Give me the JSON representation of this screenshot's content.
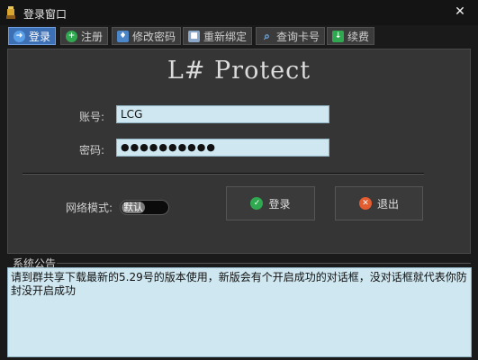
{
  "window": {
    "title": "登录窗口",
    "close_glyph": "✕"
  },
  "toolbar": {
    "items": [
      {
        "label": "登录",
        "icon": "login-icon",
        "active": true
      },
      {
        "label": "注册",
        "icon": "register-icon",
        "active": false
      },
      {
        "label": "修改密码",
        "icon": "change-password-icon",
        "active": false
      },
      {
        "label": "重新绑定",
        "icon": "rebind-icon",
        "active": false
      },
      {
        "label": "查询卡号",
        "icon": "search-icon",
        "active": false
      },
      {
        "label": "续费",
        "icon": "renew-icon",
        "active": false
      }
    ]
  },
  "brand": "L# Protect",
  "form": {
    "account_label": "账号:",
    "account_value": "LCG",
    "password_label": "密码:",
    "password_value": "●●●●●●●●●●"
  },
  "network": {
    "label": "网络模式:",
    "value": "默认"
  },
  "buttons": {
    "login": "登录",
    "exit": "退出"
  },
  "notice": {
    "label": "系统公告",
    "text": "请到群共享下载最新的5.29号的版本使用，新版会有个开启成功的对话框，没对话框就代表你防封没开启成功"
  },
  "colors": {
    "accent": "#3d6fb5",
    "field_bg": "#cfe7f0",
    "green": "#2fa84f",
    "red": "#e35b2e"
  }
}
